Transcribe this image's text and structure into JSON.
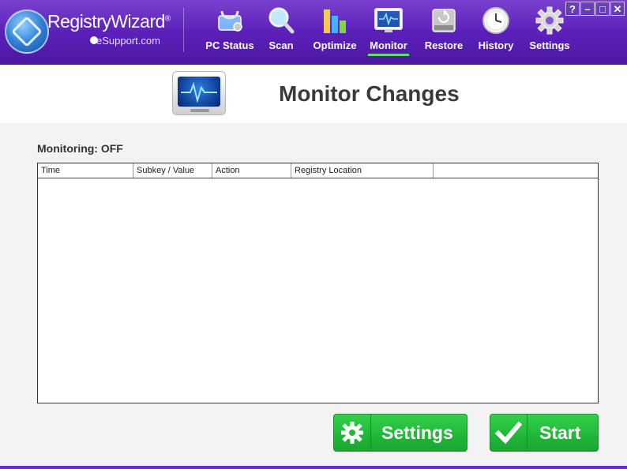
{
  "brand": {
    "name": "RegistryWizard",
    "trademark": "®",
    "sub": "eSupport.com"
  },
  "nav": [
    {
      "label": "PC Status",
      "icon": "stethoscope-icon",
      "active": false
    },
    {
      "label": "Scan",
      "icon": "magnifier-icon",
      "active": false
    },
    {
      "label": "Optimize",
      "icon": "bar-chart-icon",
      "active": false
    },
    {
      "label": "Monitor",
      "icon": "monitor-icon",
      "active": true
    },
    {
      "label": "Restore",
      "icon": "restore-drive-icon",
      "active": false
    },
    {
      "label": "History",
      "icon": "clock-icon",
      "active": false
    },
    {
      "label": "Settings",
      "icon": "gear-icon",
      "active": false
    }
  ],
  "window_controls": {
    "help": "?",
    "minimize": "–",
    "maximize": "□",
    "close": "✕"
  },
  "page": {
    "title": "Monitor Changes"
  },
  "monitoring_status": "Monitoring: OFF",
  "table": {
    "columns": [
      "Time",
      "Subkey / Value",
      "Action",
      "Registry Location"
    ],
    "rows": []
  },
  "buttons": {
    "settings": "Settings",
    "start": "Start"
  },
  "colors": {
    "header": "#5a1fb8",
    "accent_green": "#22b83a",
    "active_underline": "#5ee06a"
  }
}
